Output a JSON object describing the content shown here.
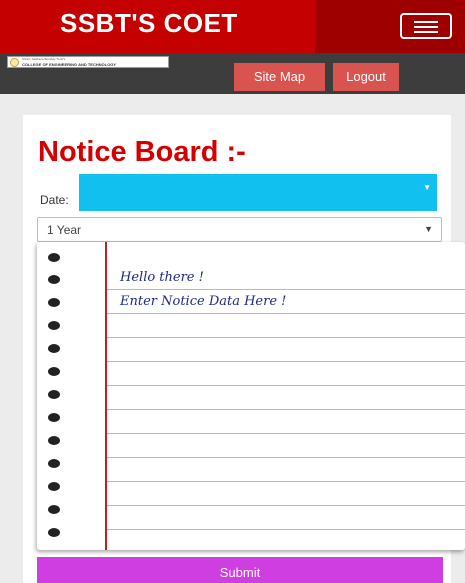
{
  "header": {
    "brand": "SSBT'S COET",
    "menu_icon": "hamburger-icon"
  },
  "subheader": {
    "logo_line1": "Shram Sadhana Bombay Trust's",
    "logo_line2": "COLLEGE OF ENGINEERING AND TECHNOLOGY",
    "site_map_label": "Site Map",
    "logout_label": "Logout"
  },
  "main": {
    "title": "Notice Board :-",
    "date_label": "Date:",
    "date_value": "",
    "duration_selected": "1 Year",
    "notice_lines": [
      "Hello there !",
      "Enter Notice Data Here !"
    ],
    "submit_label": "Submit"
  },
  "colors": {
    "header_red": "#c40000",
    "subheader_dark": "#3d3d3d",
    "nav_button": "#d9534f",
    "title_red": "#d40000",
    "date_input_blue": "#12c0f0",
    "submit_purple": "#cf3ee0",
    "ink_blue": "#1c2a8a"
  }
}
